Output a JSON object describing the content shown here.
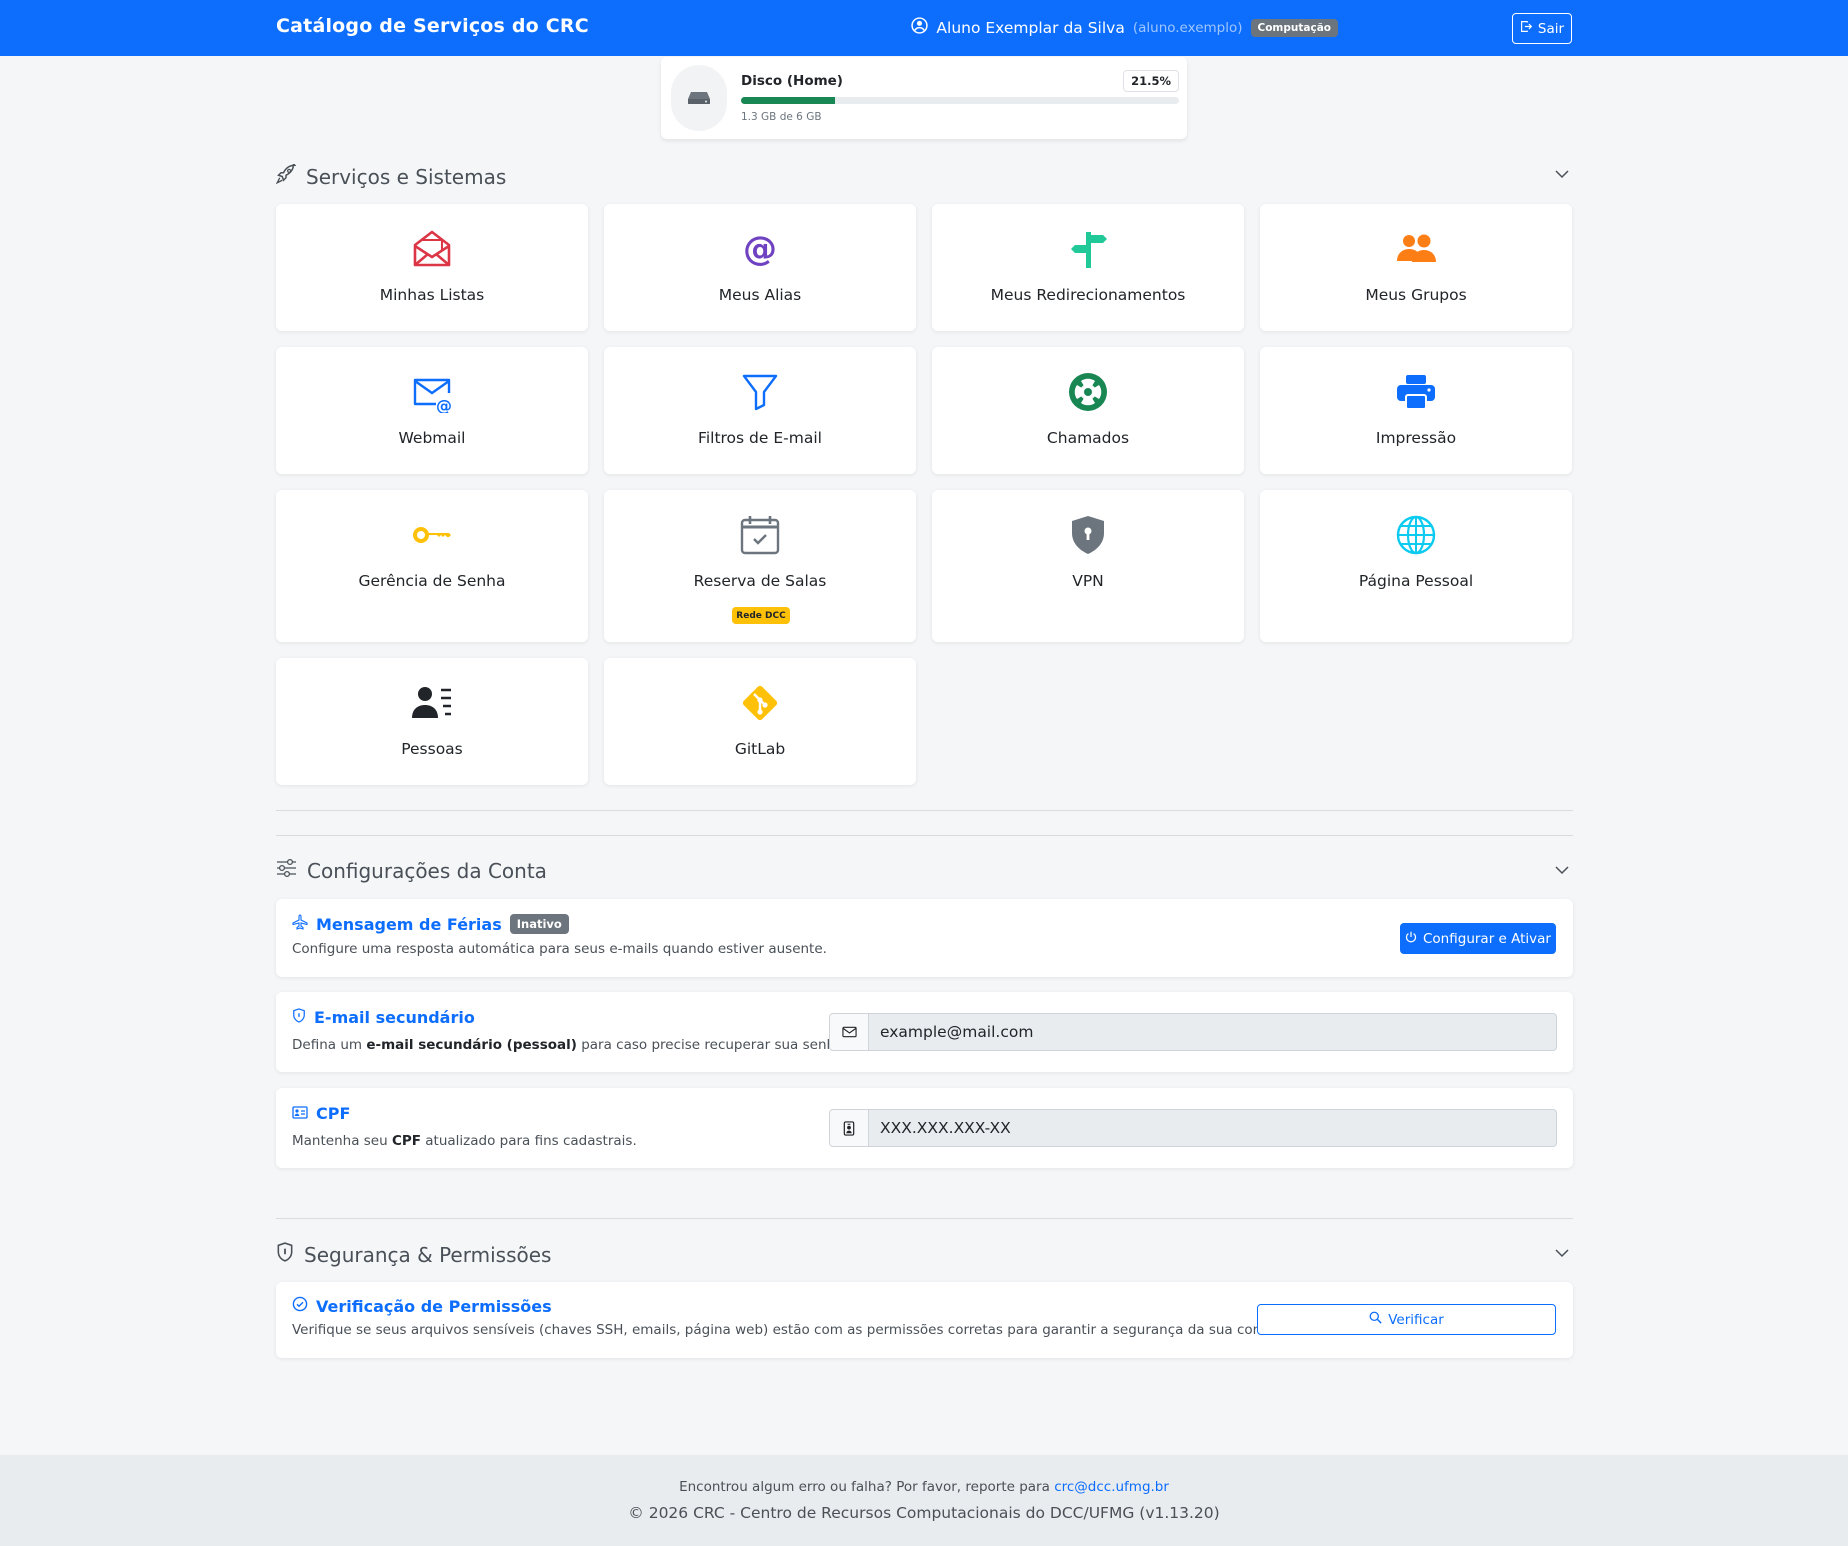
{
  "navbar": {
    "brand": "Catálogo de Serviços do CRC",
    "user_name": "Aluno Exemplar da Silva",
    "user_login": "(aluno.exemplo)",
    "user_badge": "Computação",
    "logout_label": "Sair"
  },
  "disk": {
    "title": "Disco (Home)",
    "percent_label": "21.5%",
    "percent_value": 21.5,
    "usage": "1.3 GB de 6 GB"
  },
  "sections": {
    "services_title": "Serviços e Sistemas",
    "account_title": "Configurações da Conta",
    "security_title": "Segurança & Permissões"
  },
  "services": [
    {
      "label": "Minhas Listas",
      "icon": "envelope-open-icon",
      "color": "#dc3545"
    },
    {
      "label": "Meus Alias",
      "icon": "at-icon",
      "color": "#6f42c1"
    },
    {
      "label": "Meus Redirecionamentos",
      "icon": "signpost-icon",
      "color": "#20c997"
    },
    {
      "label": "Meus Grupos",
      "icon": "people-icon",
      "color": "#fd7e14"
    },
    {
      "label": "Webmail",
      "icon": "envelope-at-icon",
      "color": "#0d6efd"
    },
    {
      "label": "Filtros de E-mail",
      "icon": "funnel-icon",
      "color": "#0d6efd"
    },
    {
      "label": "Chamados",
      "icon": "life-ring-icon",
      "color": "#198754"
    },
    {
      "label": "Impressão",
      "icon": "printer-icon",
      "color": "#0d6efd"
    },
    {
      "label": "Gerência de Senha",
      "icon": "key-icon",
      "color": "#ffc107"
    },
    {
      "label": "Reserva de Salas",
      "icon": "calendar-check-icon",
      "color": "#6c757d",
      "badge": "Rede DCC"
    },
    {
      "label": "VPN",
      "icon": "shield-lock-icon",
      "color": "#6c757d"
    },
    {
      "label": "Página Pessoal",
      "icon": "globe-icon",
      "color": "#0dcaf0"
    },
    {
      "label": "Pessoas",
      "icon": "person-lines-icon",
      "color": "#212529"
    },
    {
      "label": "GitLab",
      "icon": "git-icon",
      "color": "#ffc107"
    }
  ],
  "vacation": {
    "title": "Mensagem de Férias",
    "status": "Inativo",
    "description": "Configure uma resposta automática para seus e-mails quando estiver ausente.",
    "button_label": "Configurar e Ativar"
  },
  "secondary_email": {
    "title": "E-mail secundário",
    "desc_before": "Defina um ",
    "desc_bold": "e-mail secundário (pessoal)",
    "desc_after": " para caso precise recuperar sua senha.",
    "value": "example@mail.com"
  },
  "cpf": {
    "title": "CPF",
    "desc_before": "Mantenha seu ",
    "desc_bold": "CPF",
    "desc_after": " atualizado para fins cadastrais.",
    "value": "XXX.XXX.XXX-XX"
  },
  "permissions": {
    "title": "Verificação de Permissões",
    "description": "Verifique se seus arquivos sensíveis (chaves SSH, emails, página web) estão com as permissões corretas para garantir a segurança da sua conta.",
    "button_label": "Verificar"
  },
  "footer": {
    "report_text": "Encontrou algum erro ou falha? Por favor, reporte para ",
    "report_email": "crc@dcc.ufmg.br",
    "copyright": "© 2026 CRC - Centro de Recursos Computacionais do DCC/UFMG (v1.13.20)"
  },
  "colors": {
    "primary": "#0d6efd",
    "success": "#198754",
    "secondary": "#6c757d",
    "warning": "#ffc107"
  }
}
